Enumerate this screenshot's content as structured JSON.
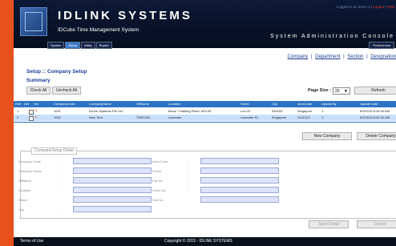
{
  "header": {
    "brand": "IDLINK SYSTEMS",
    "subtitle": "IDCube Time Management System",
    "console": "System Administration Console",
    "logged_in_prefix": "Logged in as demo 1 |",
    "logged_in_links": [
      "Logout",
      "Help"
    ],
    "nav": [
      "System",
      "Setup",
      "Utility",
      "Report"
    ],
    "active_nav": "Setup",
    "preferences": "Preferences"
  },
  "quick_links": [
    "Company",
    "Department",
    "Section",
    "Designation"
  ],
  "page": {
    "breadcrumb": "Setup :: Company Setup",
    "summary": "Summary",
    "check_all": "Check All",
    "uncheck_all": "Uncheck All",
    "page_size_label": "Page Size :",
    "page_size_value": "20",
    "refresh": "Refresh"
  },
  "table": {
    "headers": [
      "Edit",
      "Del",
      "Sel",
      "CompanyCode",
      "CompanyName",
      "OffName",
      "Location",
      "Street",
      "City",
      "AreaCode",
      "Update By",
      "Update Date"
    ],
    "rows": [
      {
        "no": "1",
        "code": "1001",
        "name": "IDLink Systems Pte Ltd.",
        "off": "",
        "location": "Block 7 Kallang Place, #03-05",
        "street": "Loh 20",
        "city": "339153",
        "area": "Singapore",
        "by": "1",
        "date": "6/9/2015 8:34:00 AM"
      },
      {
        "no": "2",
        "code": "1002",
        "name": "New Tech",
        "off": "TMS1002",
        "location": "Lavender",
        "street": "Lavender St.",
        "city": "Singapore",
        "area": "1242123",
        "by": "1",
        "date": "6/9/2015 8:34:00 AM"
      }
    ]
  },
  "actions": {
    "new_company": "New Company",
    "delete_company": "Delete Company"
  },
  "detail": {
    "legend": "CompanySetup Detail",
    "left_labels": [
      "Company Code",
      "Company Name",
      "OffName",
      "Location",
      "Street",
      "City"
    ],
    "right_labels": [
      "Area Code",
      "Phone",
      "Fax No",
      "Home No",
      "Unit No"
    ],
    "save": "Save Detail",
    "cancel": "Cancel"
  },
  "footer": {
    "terms": "Terms of Use",
    "copyright": "Copyright © 2015 - IDLINK SYSTEMS"
  },
  "colors": {
    "accent": "#2d73c4",
    "page_bg": "#e8501e",
    "header": "#0c1a38",
    "title_blue": "#1a3c9a"
  }
}
